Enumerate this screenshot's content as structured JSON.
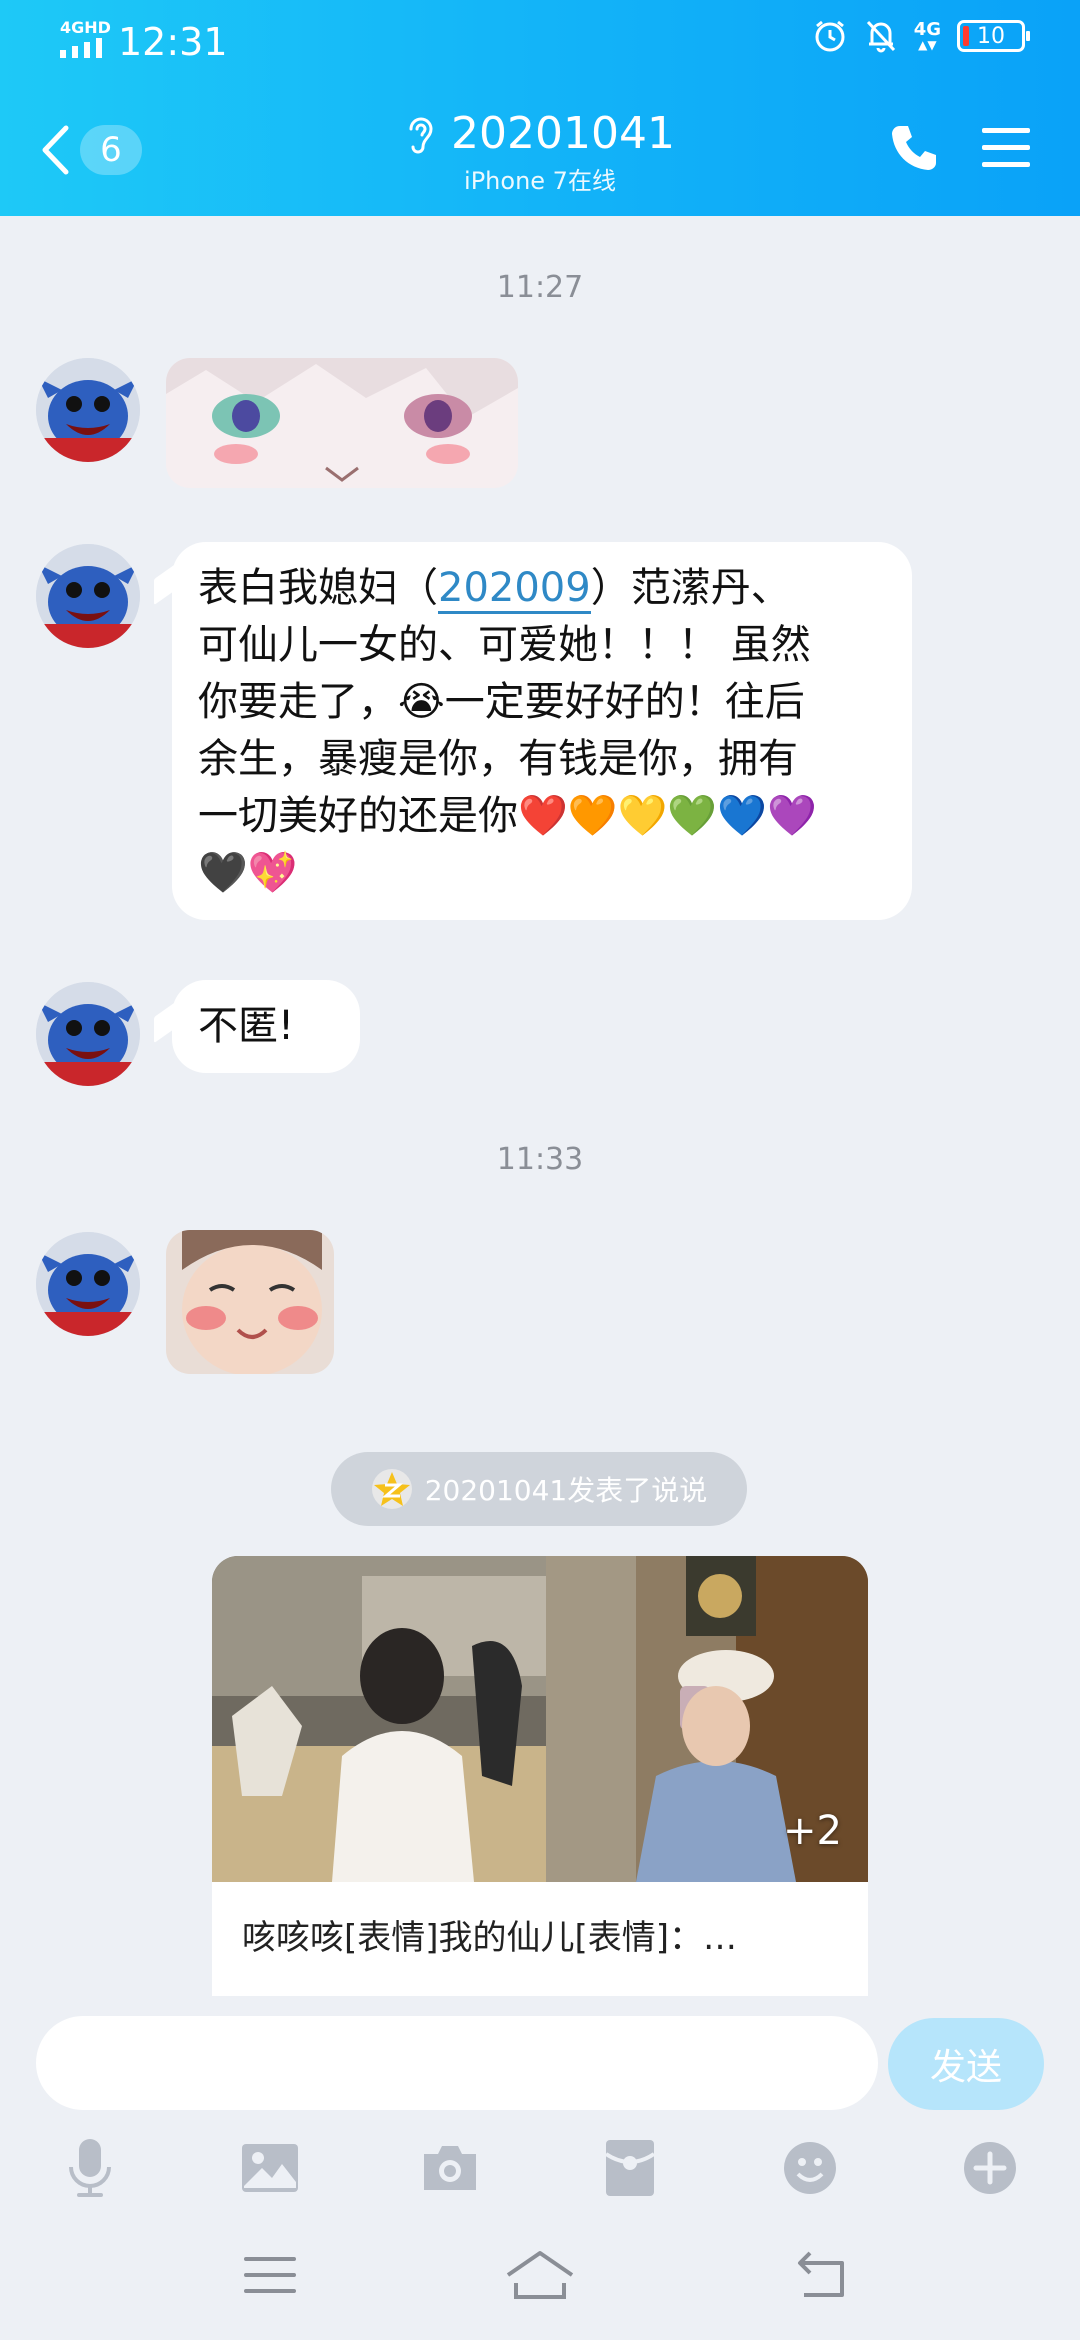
{
  "status_bar": {
    "network": "4GHD",
    "time": "12:31",
    "mobile_data": "4G",
    "battery": "10"
  },
  "header": {
    "unread_count": "6",
    "contact_name": "20201041",
    "contact_status": "iPhone 7在线"
  },
  "messages": [
    {
      "type": "time",
      "text": "11:27"
    },
    {
      "type": "sticker",
      "description_icon": "anime-eyes-sticker"
    },
    {
      "type": "text",
      "lines": [
        [
          "表白我媳妇（",
          "202009",
          "）范潆丹、"
        ],
        "可仙儿一女的、可爱她！！！ 虽然",
        "你要走了，😭一定要好好的！往后",
        "余生，暴瘦是你，有钱是你，拥有",
        "一切美好的还是你❤️🧡💛💚💙💜",
        "🖤💖"
      ]
    },
    {
      "type": "text",
      "text": "不匿!"
    },
    {
      "type": "time",
      "text": "11:33"
    },
    {
      "type": "sticker",
      "description_icon": "blushing-baby-sticker"
    }
  ],
  "feed_notice": {
    "text": "20201041发表了说说",
    "icon": "qzone-icon"
  },
  "feed_card": {
    "text": "咳咳咳[表情]我的仙儿[表情]：…",
    "more_photos": "+2"
  },
  "composer": {
    "placeholder": "",
    "send_label": "发送"
  },
  "colors": {
    "header_start": "#1ec9f7",
    "header_end": "#0aa2f8",
    "background": "#edf0f5",
    "send_button": "#b6e5fb",
    "mention_link": "#2f89c6"
  }
}
